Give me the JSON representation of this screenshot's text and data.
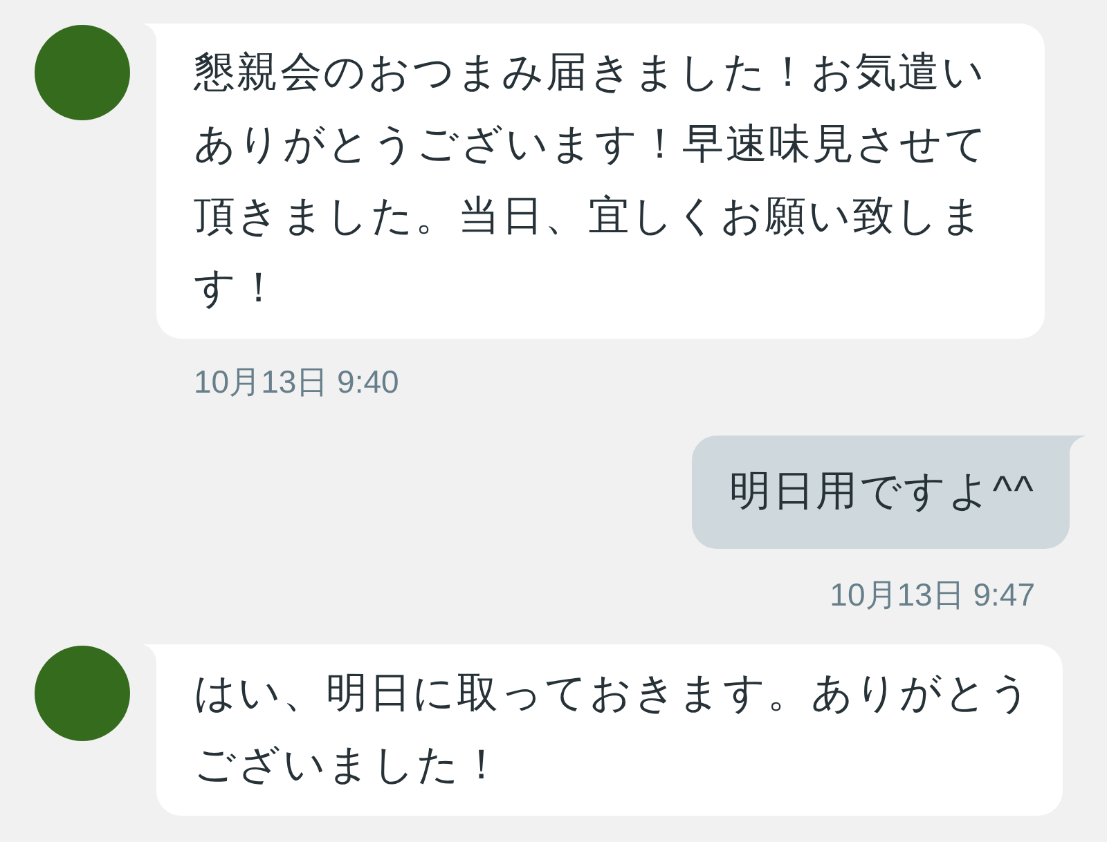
{
  "messages": [
    {
      "kind": "received",
      "text": "懇親会のおつまみ届きました！お気遣いありがとうございます！早速味見させて頂きました。当日、宜しくお願い致します！",
      "time": "10月13日 9:40"
    },
    {
      "kind": "sent",
      "text": "明日用ですよ^^",
      "time": "10月13日 9:47"
    },
    {
      "kind": "received",
      "text": "はい、明日に取っておきます。ありがとうございました！"
    }
  ]
}
